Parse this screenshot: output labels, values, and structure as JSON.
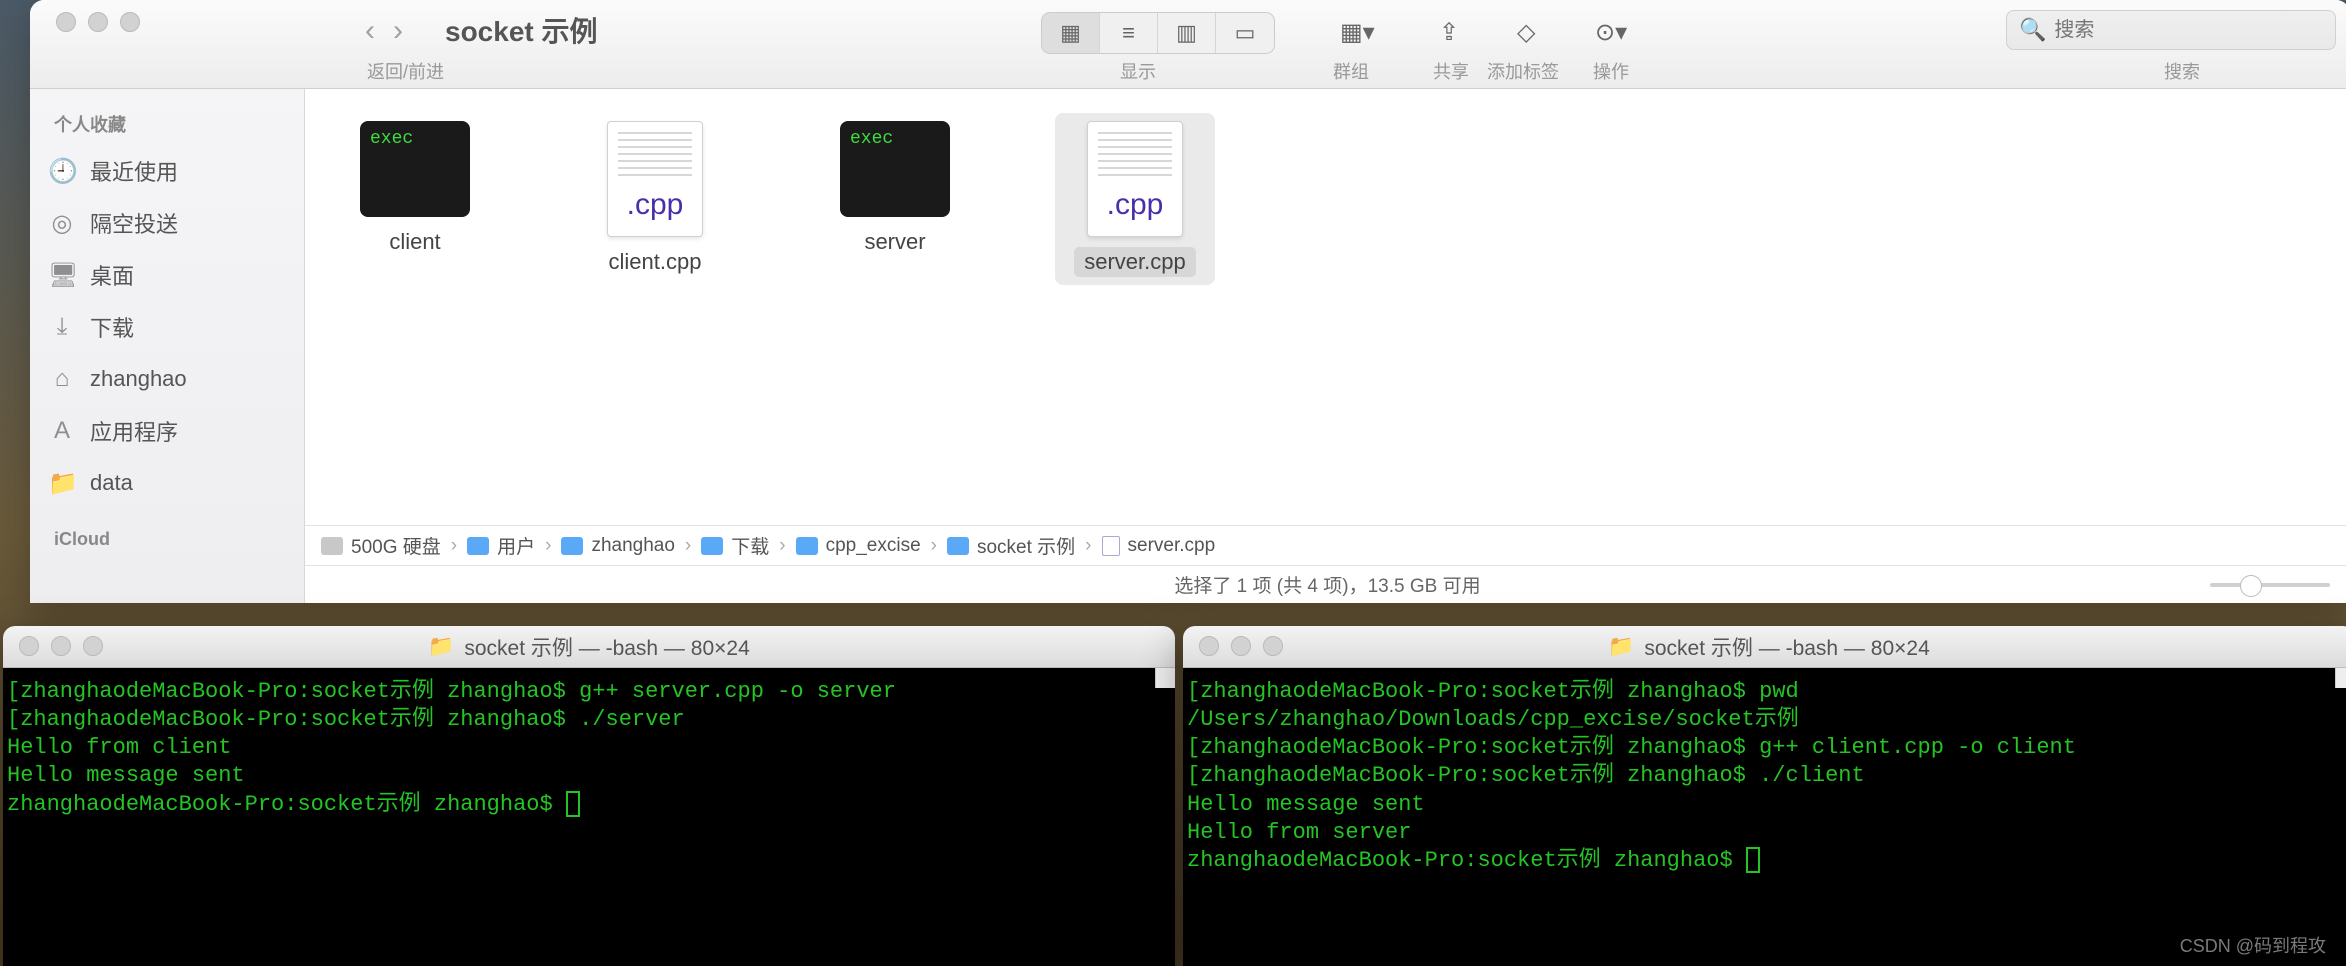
{
  "finder": {
    "title": "socket 示例",
    "nav_back_forward_label": "返回/前进",
    "view_label": "显示",
    "group_label": "群组",
    "share_label": "共享",
    "tag_label": "添加标签",
    "action_label": "操作",
    "search_placeholder": "搜索",
    "search_label": "搜索"
  },
  "sidebar": {
    "section_fav": "个人收藏",
    "items": [
      {
        "icon": "🕘",
        "label": "最近使用"
      },
      {
        "icon": "◎",
        "label": "隔空投送"
      },
      {
        "icon": "🖥",
        "label": "桌面"
      },
      {
        "icon": "⤓",
        "label": "下载"
      },
      {
        "icon": "⌂",
        "label": "zhanghao"
      },
      {
        "icon": "A",
        "label": "应用程序"
      },
      {
        "icon": "📁",
        "label": "data"
      }
    ],
    "section_icloud": "iCloud"
  },
  "files": [
    {
      "name": "client",
      "type": "exec",
      "selected": false
    },
    {
      "name": "client.cpp",
      "type": "cpp",
      "selected": false
    },
    {
      "name": "server",
      "type": "exec",
      "selected": false
    },
    {
      "name": "server.cpp",
      "type": "cpp",
      "selected": true
    }
  ],
  "path": [
    "500G 硬盘",
    "用户",
    "zhanghao",
    "下载",
    "cpp_excise",
    "socket 示例",
    "server.cpp"
  ],
  "status": "选择了 1 项 (共 4 项)，13.5 GB 可用",
  "term_left": {
    "title": "socket 示例 — -bash — 80×24",
    "lines": [
      "[zhanghaodeMacBook-Pro:socket示例 zhanghao$ g++ server.cpp -o server",
      "[zhanghaodeMacBook-Pro:socket示例 zhanghao$ ./server",
      "Hello from client",
      "Hello message sent",
      "zhanghaodeMacBook-Pro:socket示例 zhanghao$ "
    ]
  },
  "term_right": {
    "title": "socket 示例 — -bash — 80×24",
    "lines": [
      "[zhanghaodeMacBook-Pro:socket示例 zhanghao$ pwd",
      "/Users/zhanghao/Downloads/cpp_excise/socket示例",
      "[zhanghaodeMacBook-Pro:socket示例 zhanghao$ g++ client.cpp -o client",
      "[zhanghaodeMacBook-Pro:socket示例 zhanghao$ ./client",
      "Hello message sent",
      "Hello from server",
      "zhanghaodeMacBook-Pro:socket示例 zhanghao$ "
    ]
  },
  "watermark": "CSDN @码到程攻"
}
